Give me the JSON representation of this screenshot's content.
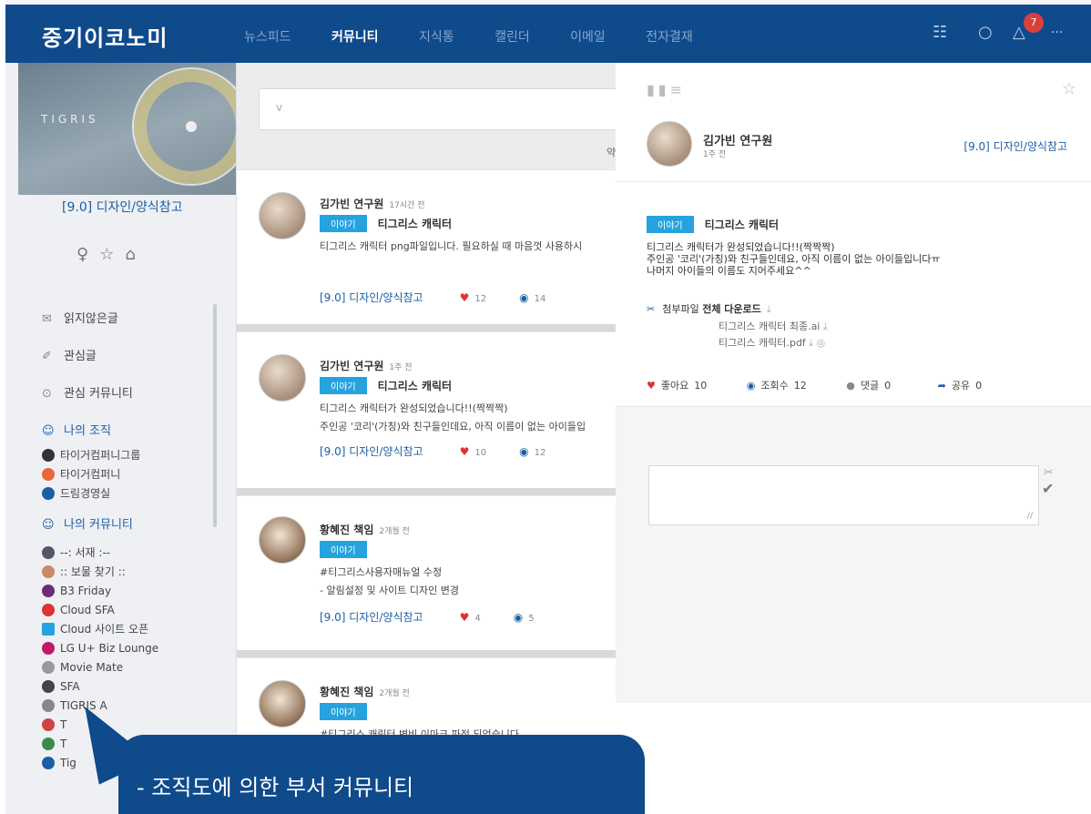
{
  "app": {
    "title": "중기이코노미"
  },
  "topnav": {
    "items": [
      "뉴스피드",
      "커뮤니티",
      "지식통",
      "캘린더",
      "이메일",
      "전자결재"
    ],
    "active_index": 1
  },
  "topicons": {
    "org_icon": "org-chart-icon",
    "chat_icon": "chat-icon",
    "bell_icon": "bell-icon",
    "badge_count": "7",
    "more": "···"
  },
  "colors": {
    "brand": "#0f4a8b",
    "accent": "#26a3de",
    "link": "#1b5ea6",
    "heart": "#dd3333"
  },
  "sidebar": {
    "cover_text": "TIGRIS",
    "community_title": "[9.0] 디자인/양식참고",
    "nav": {
      "unread": "읽지않은글",
      "interest_posts": "관심글",
      "interest_comm": "관심 커뮤니티",
      "my_org": "나의 조직",
      "my_comm": "나의 커뮤니티"
    },
    "org_items": [
      "타이거컴퍼니그룹",
      "타이거컴퍼니",
      "드림경영실"
    ],
    "comm_items": [
      "--: 서재 :--",
      ":: 보물 찾기 ::",
      "B3 Friday",
      "Cloud SFA",
      "Cloud 사이트 오픈",
      "LG U+ Biz Lounge",
      "Movie Mate",
      "SFA",
      "TIGRIS A",
      "T",
      "T",
      "Tig"
    ]
  },
  "feed": {
    "search_placeholder": "v",
    "sort_label": "약",
    "posts": [
      {
        "author": "김가빈 연구원",
        "time": "17시간 전",
        "tag": "이야기",
        "title": "티그리스 캐릭터",
        "lines": [
          "티그리스 캐릭터 png파일입니다. 필요하실 때 마음껏 사용하시"
        ],
        "community": "[9.0] 디자인/양식참고",
        "likes": "12",
        "views": "14"
      },
      {
        "author": "김가빈 연구원",
        "time": "1주 전",
        "tag": "이야기",
        "title": "티그리스 캐릭터",
        "lines": [
          "티그리스 캐릭터가 완성되었습니다!!(짝짝짝)",
          "주인공 '코리'(가칭)와 친구들인데요, 아직 이름이 없는 아이들입"
        ],
        "community": "[9.0] 디자인/양식참고",
        "likes": "10",
        "views": "12"
      },
      {
        "author": "황혜진 책임",
        "time": "2개월 전",
        "tag": "이야기",
        "title": "",
        "lines": [
          "#티그리스사용자매뉴얼 수정",
          "- 알림설정 및 사이트 디자인 변경"
        ],
        "community": "[9.0] 디자인/양식참고",
        "likes": "4",
        "views": "5"
      },
      {
        "author": "황혜진 책임",
        "time": "2개월 전",
        "tag": "이야기",
        "title": "",
        "lines": [
          "#티그리스 캐릭터 변비 이마크 파정 되었습니다"
        ],
        "community": "",
        "likes": "",
        "views": ""
      }
    ]
  },
  "detail": {
    "author": "김가빈 연구원",
    "time": "1주 전",
    "community": "[9.0] 디자인/양식참고",
    "tag": "이야기",
    "title": "티그리스 캐릭터",
    "body": [
      "티그리스 캐릭터가 완성되었습니다!!(짝짝짝)",
      "주인공 '코리'(가칭)와 친구들인데요, 아직 이름이 없는 아이들입니다ㅠ",
      "나머지 아이들의 이름도 지어주세요^^"
    ],
    "attach_label": "첨부파일",
    "download_all": "전체 다운로드",
    "files": [
      "티그리스 캐릭터 최종.ai",
      "티그리스 캐릭터.pdf"
    ],
    "stats": {
      "like_label": "좋아요",
      "like": "10",
      "view_label": "조회수",
      "view": "12",
      "comment_label": "댓글",
      "comment": "0",
      "share_label": "공유",
      "share": "0"
    }
  },
  "callout": {
    "text": "- 조직도에 의한 부서 커뮤니티"
  }
}
